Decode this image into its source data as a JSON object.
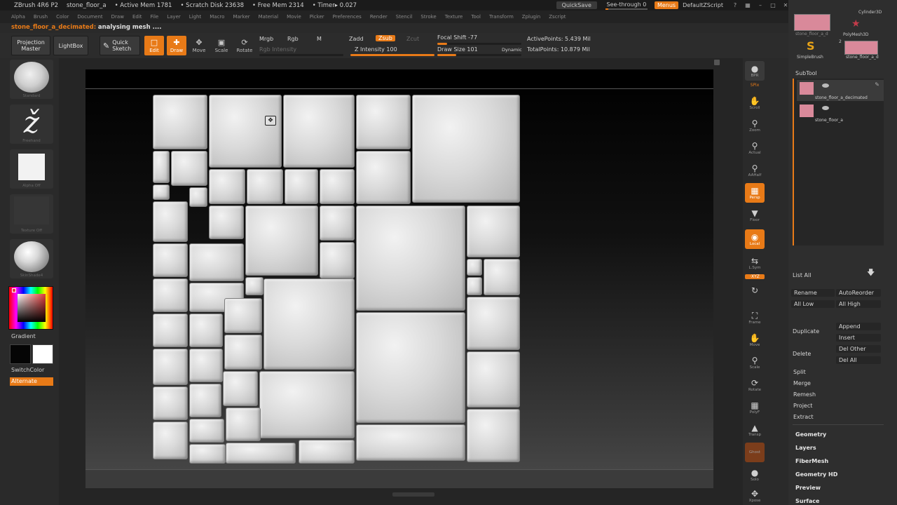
{
  "titlebar": {
    "app": "ZBrush 4R6 P2",
    "doc": "stone_floor_a",
    "active_mem": "• Active Mem 1781",
    "scratch": "• Scratch Disk 23638",
    "free_mem": "• Free Mem 2314",
    "timer": "• Timer▸ 0.027",
    "quicksave": "QuickSave",
    "seethrough": "See-through   0",
    "menus": "Menus",
    "script": "DefaultZScript"
  },
  "menubar": [
    "Alpha",
    "Brush",
    "Color",
    "Document",
    "Draw",
    "Edit",
    "File",
    "Layer",
    "Light",
    "Macro",
    "Marker",
    "Material",
    "Movie",
    "Picker",
    "Preferences",
    "Render",
    "Stencil",
    "Stroke",
    "Texture",
    "Tool",
    "Transform",
    "Zplugin",
    "Zscript"
  ],
  "status": {
    "name": "stone_floor_a_decimated:",
    "message": "analysing mesh ...."
  },
  "toolbar": {
    "projection_master": "Projection Master",
    "lightbox": "LightBox",
    "quick_sketch": "Quick Sketch",
    "edit": "Edit",
    "draw": "Draw",
    "move": "Move",
    "scale": "Scale",
    "rotate": "Rotate",
    "mrgb": "Mrgb",
    "rgb": "Rgb",
    "m": "M",
    "rgb_intensity": "Rgb Intensity",
    "zadd": "Zadd",
    "zsub": "Zsub",
    "zcut": "Zcut",
    "z_intensity": "Z Intensity 100",
    "z_intensity_value": 100,
    "focal_shift": "Focal Shift -77",
    "focal_shift_value": -77,
    "draw_size": "Draw Size 101",
    "draw_size_value": 101,
    "dynamic": "Dynamic",
    "active_points": "ActivePoints: 5.439 Mil",
    "total_points": "TotalPoints: 10.879 Mil"
  },
  "leftshelf": {
    "brush_label": "Standard",
    "stroke_label": "Freehand",
    "alpha_label": "Alpha Off",
    "texture_label": "Texture Off",
    "material_label": "SkinShade4",
    "gradient": "Gradient",
    "switchcolor": "SwitchColor",
    "alternate": "Alternate",
    "main_color": "#e43a3a",
    "secondary_color": "#ffffff"
  },
  "rightdock": {
    "bpr": "BPR",
    "spix": "SPix",
    "scroll": "Scroll",
    "zoom": "Zoom",
    "actual": "Actual",
    "aahalf": "AAHalf",
    "persp": "Persp",
    "floor": "Floor",
    "local": "Local",
    "lsym": "L.Sym",
    "xyz": "·XYZ",
    "frame": "Frame",
    "move": "Move",
    "scale": "Scale",
    "rotate": "Rotate",
    "polyf": "PolyF",
    "transp": "Transp",
    "ghost": "Ghost",
    "solo": "Solo",
    "xpose": "Xpose"
  },
  "panel": {
    "thumbs": {
      "cylinder": "Cylinder3D",
      "floor_a": "stone_floor_a_d",
      "polymesh": "PolyMesh3D",
      "simplebrush": "SimpleBrush",
      "floor_b": "stone_floor_a_d",
      "count": "2"
    },
    "subtool": "SubTool",
    "items": [
      {
        "name": "stone_floor_a_decimated"
      },
      {
        "name": "stone_floor_a"
      }
    ],
    "list_all": "List All",
    "rename": "Rename",
    "autoreorder": "AutoReorder",
    "all_low": "All Low",
    "all_high": "All High",
    "duplicate": "Duplicate",
    "append": "Append",
    "insert": "Insert",
    "delete": "Delete",
    "del_other": "Del Other",
    "del_all": "Del All",
    "split": "Split",
    "merge": "Merge",
    "remesh": "Remesh",
    "project": "Project",
    "extract": "Extract",
    "geometry": "Geometry",
    "layers": "Layers",
    "fibermesh": "FiberMesh",
    "geometry_hd": "Geometry HD",
    "preview": "Preview",
    "surface": "Surface"
  },
  "colors": {
    "accent": "#e87a17",
    "background": "#2a2a2a",
    "thumbnail": "#d9899a"
  }
}
